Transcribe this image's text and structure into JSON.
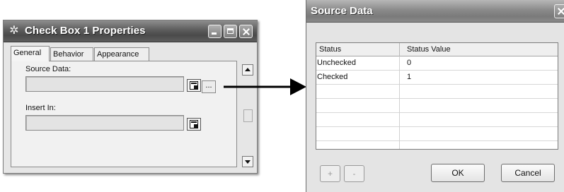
{
  "properties_window": {
    "title": "Check Box 1 Properties",
    "icon": "gear-icon",
    "tabs": [
      {
        "label": "General",
        "active": true
      },
      {
        "label": "Behavior",
        "active": false
      },
      {
        "label": "Appearance",
        "active": false
      }
    ],
    "source_data_label": "Source Data:",
    "source_data_value": "",
    "ellipsis_label": "...",
    "insert_in_label": "Insert In:",
    "insert_in_value": ""
  },
  "source_data_dialog": {
    "title": "Source Data",
    "columns": [
      "Status",
      "Status Value"
    ],
    "rows": [
      {
        "status": "Unchecked",
        "value": "0"
      },
      {
        "status": "Checked",
        "value": "1"
      }
    ],
    "add_label": "+",
    "remove_label": "-",
    "ok_label": "OK",
    "cancel_label": "Cancel"
  }
}
